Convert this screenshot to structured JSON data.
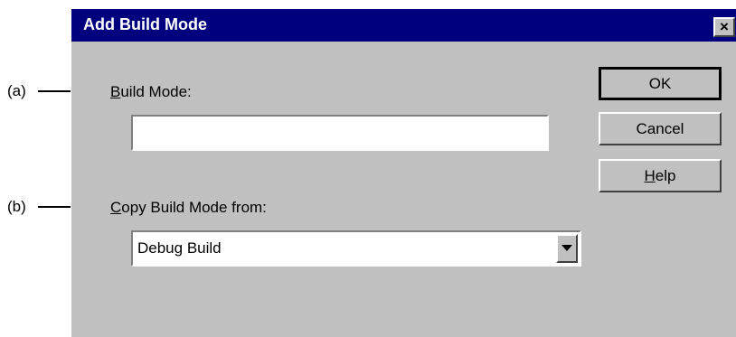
{
  "callouts": {
    "a": "(a)",
    "b": "(b)"
  },
  "dialog": {
    "title": "Add Build Mode",
    "close_symbol": "×",
    "build_mode": {
      "label_mnemonic": "B",
      "label_rest": "uild Mode:",
      "value": ""
    },
    "copy_from": {
      "label_mnemonic": "C",
      "label_rest": "opy Build Mode from:",
      "selected": "Debug Build"
    },
    "buttons": {
      "ok": "OK",
      "cancel": "Cancel",
      "help_mnemonic": "H",
      "help_rest": "elp"
    }
  },
  "colors": {
    "titlebar": "#00007f",
    "dialog_face": "#c0c0c0"
  },
  "icons": {
    "close": "close-icon",
    "dropdown": "chevron-down-icon"
  }
}
